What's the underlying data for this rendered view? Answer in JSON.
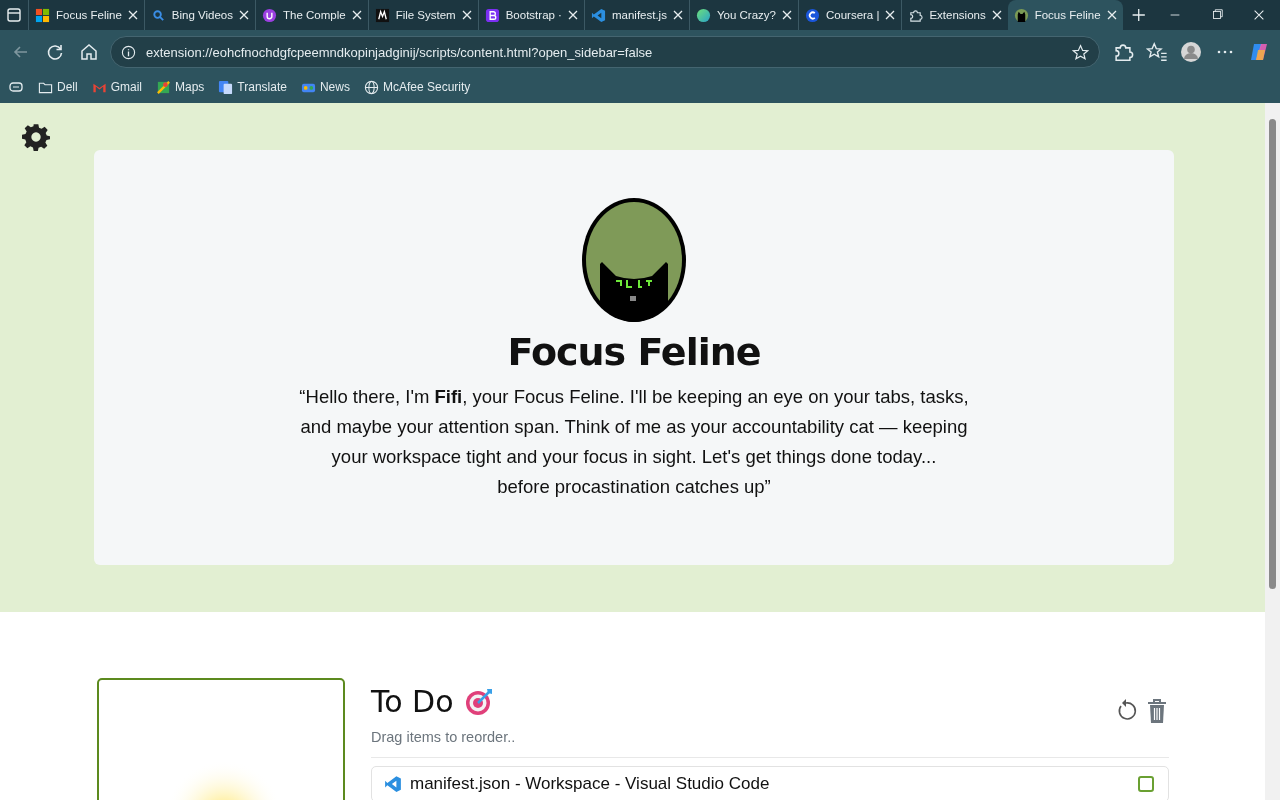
{
  "browser": {
    "tabs": [
      {
        "title": "Focus Feline",
        "selected": false
      },
      {
        "title": "Bing Videos",
        "selected": false
      },
      {
        "title": "The Comple",
        "selected": false
      },
      {
        "title": "File System",
        "selected": false
      },
      {
        "title": "Bootstrap ·",
        "selected": false
      },
      {
        "title": "manifest.js",
        "selected": false
      },
      {
        "title": "You Crazy?",
        "selected": false
      },
      {
        "title": "Coursera |",
        "selected": false
      },
      {
        "title": "Extensions",
        "selected": false
      },
      {
        "title": "Focus Feline",
        "selected": true
      }
    ],
    "address": "extension://eohcfnochdgfcpeemndkopinjadginij/scripts/content.html?open_sidebar=false",
    "bookmarks": [
      {
        "label": "Dell"
      },
      {
        "label": "Gmail"
      },
      {
        "label": "Maps"
      },
      {
        "label": "Translate"
      },
      {
        "label": "News"
      },
      {
        "label": "McAfee Security"
      }
    ]
  },
  "hero": {
    "title": "Focus Feline",
    "quote": "“Hello there, I'm **Fifi**, your Focus Feline. I'll be keeping an eye on your tabs, tasks, and maybe your attention span. Think of me as your accountability cat — keeping your workspace tight and your focus in sight. Let's get things done today...\nbefore procastination catches up”"
  },
  "todo": {
    "title": "To Do",
    "hint": "Drag items to reorder..",
    "items": [
      {
        "text": "manifest.json - Workspace - Visual Studio Code",
        "checked": false
      }
    ]
  }
}
